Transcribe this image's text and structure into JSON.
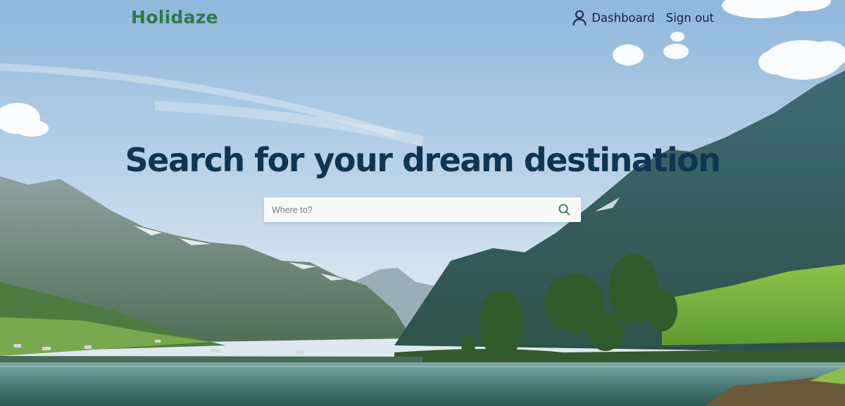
{
  "header": {
    "logo_text": "Holidaze",
    "nav": [
      {
        "label": "Dashboard",
        "icon": "user-icon"
      },
      {
        "label": "Sign out"
      }
    ]
  },
  "hero": {
    "headline": "Search for your dream destination",
    "background": "mountain-fjord-landscape-photo"
  },
  "search": {
    "placeholder": "Where to?",
    "value": "",
    "icon": "search-icon"
  },
  "colors": {
    "brand_green": "#2f7a47",
    "headline_navy": "#0f3552",
    "nav_text": "#14213d",
    "search_bg": "#f7f8f8"
  }
}
